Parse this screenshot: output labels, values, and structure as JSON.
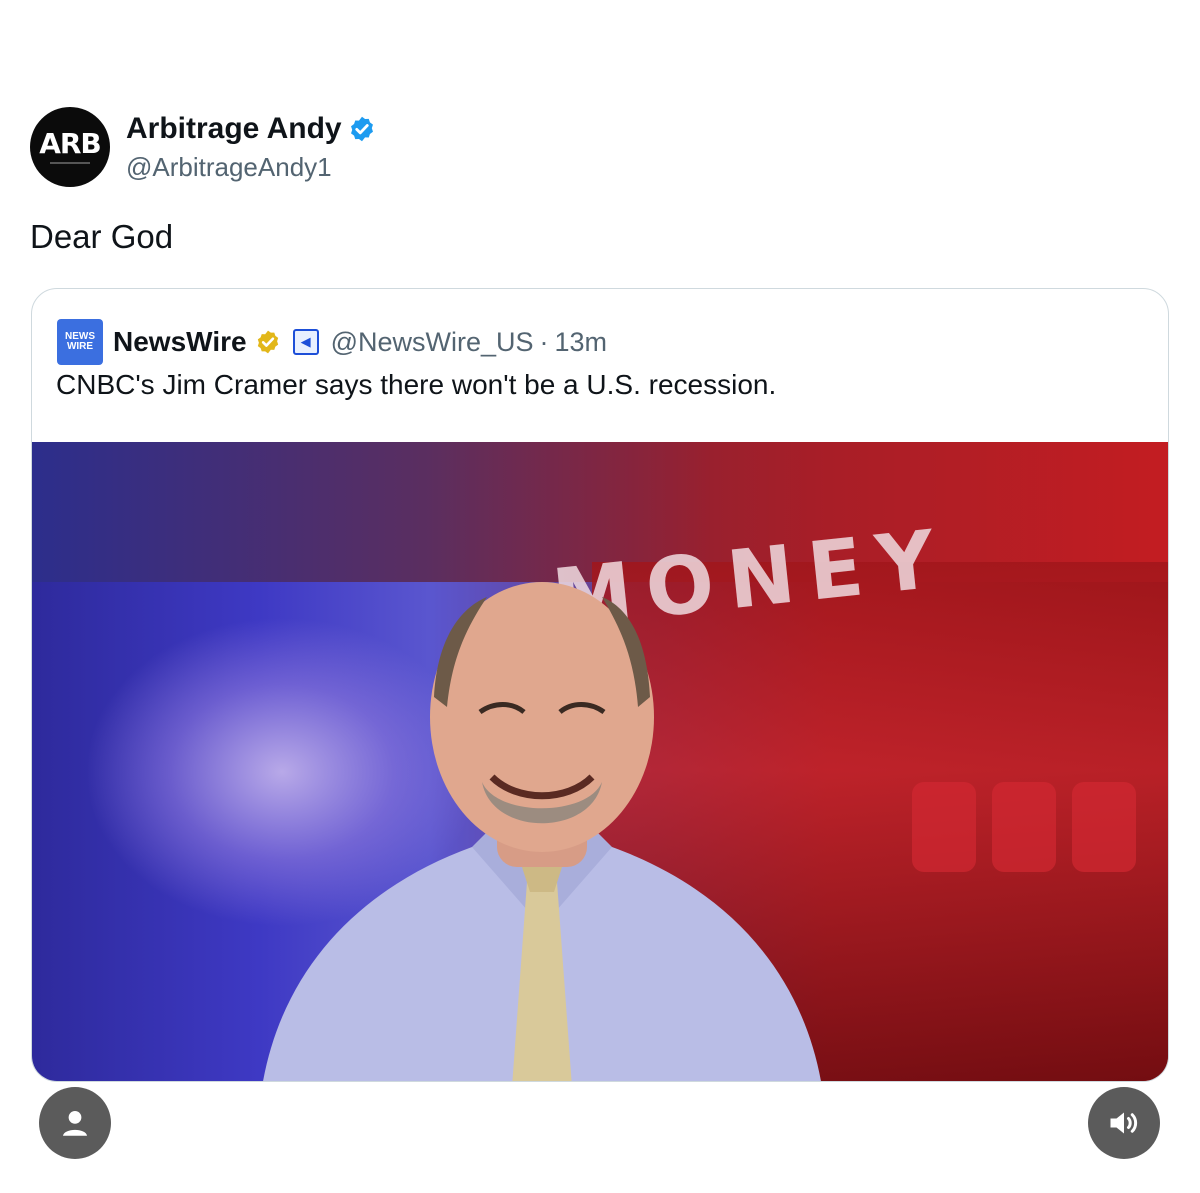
{
  "tweet": {
    "avatar_text": "ARB",
    "display_name": "Arbitrage Andy",
    "handle": "@ArbitrageAndy1",
    "text": "Dear God"
  },
  "quote": {
    "avatar_text_top": "NEWS",
    "avatar_text_bottom": "WIRE",
    "display_name": "NewsWire",
    "handle": "@NewsWire_US",
    "separator": "·",
    "time": "13m",
    "text": "CNBC's Jim Cramer says there won't be a U.S. recession.",
    "image_text": "MONEY"
  },
  "controls": {
    "left_icon": "person-icon",
    "right_icon": "speaker-icon"
  },
  "colors": {
    "verified_blue": "#1d9bf0",
    "gold_badge": "#e2b719",
    "handle_gray": "#536471",
    "card_border": "#cfd9de",
    "control_bg": "#5b5b5b"
  }
}
